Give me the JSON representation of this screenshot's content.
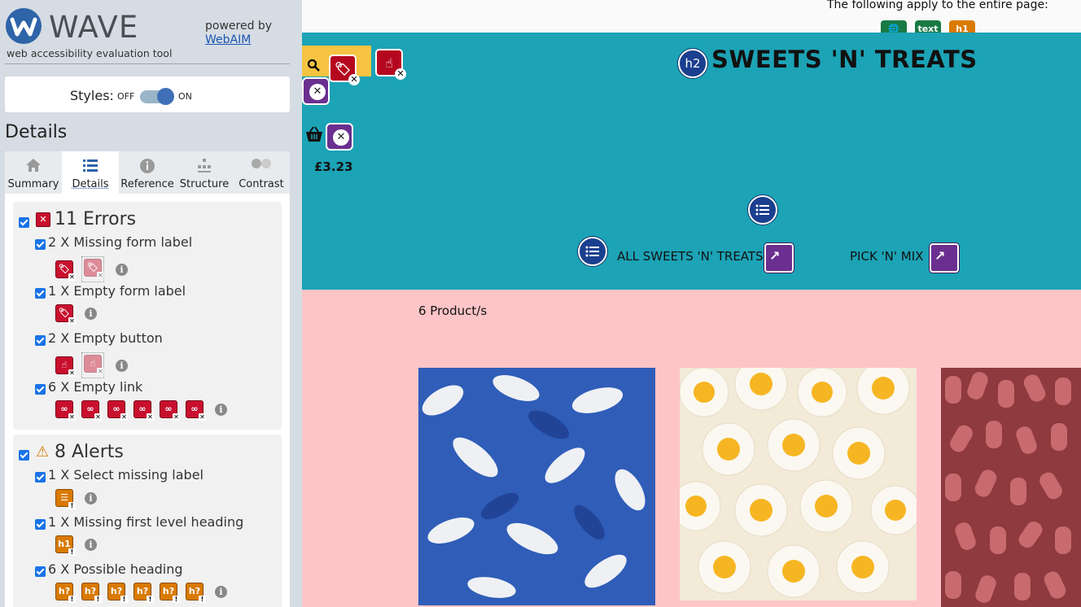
{
  "wave": {
    "title": "WAVE",
    "subtitle": "web accessibility evaluation tool",
    "powered_by": "powered by",
    "webaim_link": "WebAIM",
    "styles_label": "Styles:",
    "styles_off": "OFF",
    "styles_on": "ON",
    "styles_enabled": true,
    "details_heading": "Details",
    "tabs": [
      {
        "label": "Summary",
        "icon": "home-icon"
      },
      {
        "label": "Details",
        "icon": "list-icon",
        "active": true
      },
      {
        "label": "Reference",
        "icon": "info-icon"
      },
      {
        "label": "Structure",
        "icon": "structure-icon"
      },
      {
        "label": "Contrast",
        "icon": "contrast-icon"
      }
    ],
    "errors": {
      "title": "11 Errors",
      "items": [
        {
          "label": "2 X Missing form label",
          "glyph": "tag"
        },
        {
          "label": "1 X Empty form label",
          "glyph": "tag"
        },
        {
          "label": "2 X Empty button",
          "glyph": "button"
        },
        {
          "label": "6 X Empty link",
          "glyph": "link"
        }
      ]
    },
    "alerts": {
      "title": "8 Alerts",
      "items": [
        {
          "label": "1 X Select missing label",
          "glyph": "select"
        },
        {
          "label": "1 X Missing first level heading",
          "glyph": "h1"
        },
        {
          "label": "6 X Possible heading",
          "glyph": "h?"
        }
      ]
    }
  },
  "page": {
    "top_note": "The following apply to the entire page:",
    "top_icons": [
      "lang",
      "text",
      "h1"
    ],
    "site_title": "SWEETS 'N' TREATS",
    "heading_icon": "h2",
    "price": "£3.23",
    "nav": [
      "ALL SWEETS 'N' TREATS",
      "PICK 'N' MIX"
    ],
    "product_count": "6 Product/s"
  },
  "colors": {
    "sidebar_bg": "#d6dce3",
    "header_bg": "#1ca3b6",
    "content_bg": "#fdc5c7",
    "error_red": "#c8102e",
    "alert_orange": "#d97a00",
    "structure_purple": "#6a2f8f",
    "search_yellow": "#f6c442"
  }
}
